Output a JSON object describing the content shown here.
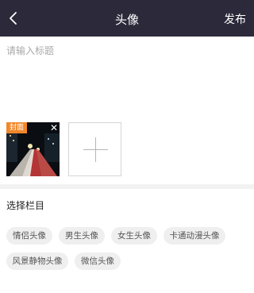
{
  "header": {
    "title": "头像",
    "publish_label": "发布"
  },
  "editor": {
    "title_placeholder": "请输入标题",
    "cover_badge": "封面"
  },
  "category": {
    "label": "选择栏目",
    "chips": [
      "情侣头像",
      "男生头像",
      "女生头像",
      "卡通动漫头像",
      "风景静物头像",
      "微信头像"
    ]
  }
}
